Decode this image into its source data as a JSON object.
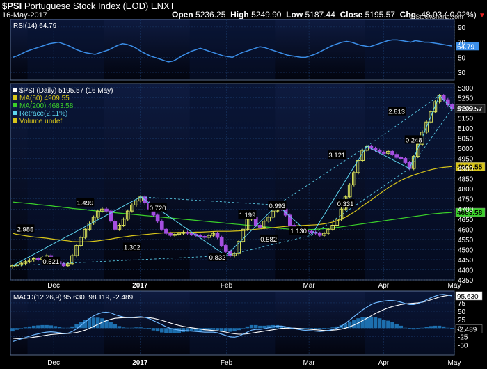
{
  "header": {
    "symbol": "$PSI",
    "name": "Portuguese Stock Index (EOD)",
    "exchange": "ENXT",
    "date": "16-May-2017",
    "open_label": "Open",
    "open": "5236.25",
    "high_label": "High",
    "high": "5249.90",
    "low_label": "Low",
    "low": "5187.44",
    "close_label": "Close",
    "close": "5195.57",
    "chg_label": "Chg",
    "chg": "-48.03 (-0.92%)",
    "copyright": "© StockCharts.com"
  },
  "colors": {
    "background": "#000000",
    "panel_top": "#0e1b40",
    "panel_bottom": "#02040e",
    "shade": "#061028",
    "grid": "#1c3d6e",
    "rsi": "#3b8ee8",
    "ma50": "#d8c61a",
    "ma200": "#3bd02a",
    "retrace": "#5fd6f0",
    "candle_up": "#d8e05a",
    "candle_down": "#a44fe0",
    "macd_line": "#6fb8ff",
    "signal_line": "#ffffff",
    "histogram": "#1d6fae",
    "chg_negative": "#e02020"
  },
  "rsi_panel": {
    "legend": "RSI(14) 64.79",
    "badge": "64.79",
    "ticks": [
      "90",
      "70",
      "50",
      "30"
    ],
    "values": [
      50,
      52,
      55,
      58,
      60,
      62,
      64,
      66,
      68,
      69,
      70,
      68,
      66,
      63,
      60,
      58,
      56,
      55,
      54,
      56,
      58,
      60,
      63,
      66,
      68,
      67,
      65,
      62,
      58,
      55,
      52,
      50,
      48,
      46,
      44,
      45,
      48,
      52,
      55,
      58,
      60,
      62,
      60,
      58,
      56,
      54,
      52,
      51,
      50,
      53,
      56,
      58,
      60,
      62,
      64,
      63,
      61,
      59,
      57,
      55,
      53,
      52,
      51,
      50,
      50,
      52,
      54,
      57,
      60,
      63,
      66,
      68,
      70,
      71,
      70,
      68,
      66,
      65,
      64,
      66,
      68,
      70,
      72,
      73,
      73,
      72,
      71,
      70,
      72,
      71,
      70,
      70,
      69,
      68,
      67,
      66,
      65
    ]
  },
  "price_panel": {
    "legend": [
      {
        "text": "$PSI (Daily) 5195.57 (16 May)",
        "kind": "price"
      },
      {
        "text": "MA(50) 4909.55",
        "kind": "ma50"
      },
      {
        "text": "MA(200) 4683.58",
        "kind": "ma200"
      },
      {
        "text": "Retrace(2.11%)",
        "kind": "retrace"
      },
      {
        "text": "Volume undef",
        "kind": "volume"
      }
    ],
    "ticks": [
      "5300",
      "5250",
      "5200",
      "5150",
      "5100",
      "5050",
      "5000",
      "4950",
      "4900",
      "4850",
      "4800",
      "4750",
      "4700",
      "4650",
      "4600",
      "4550",
      "4500",
      "4450",
      "4400",
      "4350"
    ],
    "badges": [
      {
        "text": "5195.57",
        "value": 5195.57,
        "kind": "close"
      },
      {
        "text": "4909.55",
        "value": 4909.55,
        "kind": "ma50"
      },
      {
        "text": "4683.58",
        "value": 4683.58,
        "kind": "ma200"
      }
    ],
    "retrace_labels": [
      {
        "text": "2.985",
        "value": 4600
      },
      {
        "text": "0.521",
        "value": 4440
      },
      {
        "text": "1.499",
        "value": 4730
      },
      {
        "text": "1.302",
        "value": 4510
      },
      {
        "text": "0.720",
        "value": 4705
      },
      {
        "text": "0.832",
        "value": 4460
      },
      {
        "text": "1.199",
        "value": 4670
      },
      {
        "text": "0.993",
        "value": 4715
      },
      {
        "text": "0.582",
        "value": 4550
      },
      {
        "text": "1.130",
        "value": 4590
      },
      {
        "text": "3.121",
        "value": 4965
      },
      {
        "text": "0.331",
        "value": 4725
      },
      {
        "text": "2.813",
        "value": 5180
      },
      {
        "text": "0.248",
        "value": 5040
      }
    ]
  },
  "macd_panel": {
    "legend": "MACD(12,26,9) 95.630, 98.119, -2.489",
    "ticks": [
      "75",
      "50",
      "25",
      "0",
      "-25",
      "-50"
    ],
    "badges": [
      {
        "text": "95.630",
        "value": 95.63,
        "kind": "macd"
      },
      {
        "text": "-2.489",
        "value": -2.489,
        "kind": "hist"
      }
    ]
  },
  "x_axis": {
    "labels": [
      "Dec",
      "2017",
      "Feb",
      "Mar",
      "Apr",
      "May"
    ]
  },
  "chart_data": {
    "type": "candlestick",
    "title": "$PSI Portuguese Stock Index (EOD) ENXT",
    "ylim": [
      4350,
      5320
    ],
    "x_labels": [
      "Dec",
      "2017",
      "Feb",
      "Mar",
      "Apr",
      "May"
    ],
    "close": [
      4420,
      4425,
      4432,
      4440,
      4448,
      4455,
      4450,
      4460,
      4470,
      4455,
      4440,
      4430,
      4420,
      4430,
      4470,
      4520,
      4560,
      4600,
      4630,
      4660,
      4690,
      4700,
      4690,
      4640,
      4600,
      4620,
      4650,
      4690,
      4720,
      4740,
      4760,
      4730,
      4700,
      4670,
      4640,
      4600,
      4580,
      4570,
      4575,
      4580,
      4585,
      4580,
      4575,
      4570,
      4565,
      4560,
      4570,
      4580,
      4560,
      4520,
      4490,
      4470,
      4480,
      4540,
      4600,
      4650,
      4660,
      4620,
      4610,
      4640,
      4660,
      4690,
      4710,
      4700,
      4670,
      4620,
      4590,
      4600,
      4595,
      4590,
      4585,
      4580,
      4570,
      4580,
      4600,
      4620,
      4650,
      4700,
      4760,
      4820,
      4880,
      4940,
      4990,
      5010,
      5000,
      4990,
      4980,
      4975,
      4985,
      4970,
      4955,
      4950,
      4930,
      4900,
      4960,
      5020,
      5080,
      5130,
      5180,
      5230,
      5260,
      5240,
      5215,
      5195.57
    ],
    "ma50": [
      4580,
      4575,
      4572,
      4568,
      4565,
      4562,
      4560,
      4558,
      4556,
      4553,
      4550,
      4548,
      4545,
      4543,
      4540,
      4539,
      4538,
      4538,
      4539,
      4541,
      4543,
      4546,
      4549,
      4552,
      4556,
      4559,
      4562,
      4565,
      4568,
      4570,
      4572,
      4574,
      4576,
      4578,
      4580,
      4582,
      4583,
      4584,
      4584,
      4585,
      4585,
      4585,
      4585,
      4586,
      4586,
      4587,
      4588,
      4589,
      4590,
      4590,
      4590,
      4590,
      4591,
      4592,
      4594,
      4596,
      4598,
      4600,
      4602,
      4604,
      4606,
      4608,
      4610,
      4612,
      4614,
      4616,
      4617,
      4618,
      4619,
      4620,
      4621,
      4622,
      4624,
      4627,
      4631,
      4636,
      4642,
      4650,
      4660,
      4672,
      4685,
      4700,
      4715,
      4730,
      4745,
      4760,
      4775,
      4790,
      4805,
      4818,
      4830,
      4842,
      4852,
      4860,
      4868,
      4875,
      4882,
      4888,
      4894,
      4899,
      4903,
      4906,
      4908,
      4909.55
    ],
    "ma200": [
      4735,
      4733,
      4731,
      4729,
      4727,
      4725,
      4722,
      4720,
      4718,
      4716,
      4713,
      4711,
      4708,
      4706,
      4703,
      4701,
      4699,
      4697,
      4694,
      4692,
      4690,
      4688,
      4686,
      4684,
      4682,
      4680,
      4678,
      4676,
      4674,
      4672,
      4670,
      4668,
      4666,
      4664,
      4662,
      4660,
      4658,
      4656,
      4654,
      4652,
      4650,
      4648,
      4646,
      4644,
      4642,
      4640,
      4638,
      4636,
      4634,
      4632,
      4630,
      4628,
      4626,
      4624,
      4622,
      4620,
      4618,
      4616,
      4614,
      4612,
      4610,
      4608,
      4606,
      4604,
      4602,
      4600,
      4599,
      4598,
      4598,
      4598,
      4599,
      4600,
      4601,
      4603,
      4605,
      4607,
      4609,
      4612,
      4615,
      4618,
      4621,
      4624,
      4627,
      4630,
      4633,
      4636,
      4639,
      4642,
      4645,
      4648,
      4651,
      4654,
      4657,
      4660,
      4663,
      4666,
      4669,
      4672,
      4675,
      4677,
      4679,
      4681,
      4682,
      4683.58
    ],
    "macd": [
      -40,
      -36,
      -32,
      -28,
      -24,
      -20,
      -17,
      -14,
      -12,
      -11,
      -12,
      -14,
      -16,
      -15,
      -10,
      -2,
      8,
      18,
      28,
      36,
      42,
      46,
      47,
      45,
      40,
      36,
      33,
      32,
      32,
      33,
      34,
      32,
      28,
      22,
      16,
      10,
      4,
      -1,
      -4,
      -6,
      -7,
      -8,
      -9,
      -10,
      -11,
      -12,
      -12,
      -12,
      -14,
      -18,
      -22,
      -26,
      -27,
      -24,
      -18,
      -12,
      -6,
      -4,
      -4,
      -2,
      1,
      4,
      6,
      6,
      4,
      1,
      -2,
      -4,
      -6,
      -7,
      -8,
      -9,
      -10,
      -9,
      -7,
      -4,
      0,
      6,
      14,
      24,
      34,
      44,
      54,
      62,
      70,
      75,
      78,
      80,
      82,
      82,
      80,
      77,
      73,
      70,
      70,
      73,
      78,
      84,
      90,
      95,
      99,
      100,
      98,
      95.63
    ],
    "signal": [
      -30,
      -31,
      -31,
      -30,
      -29,
      -27,
      -25,
      -23,
      -21,
      -19,
      -18,
      -17,
      -17,
      -16,
      -15,
      -13,
      -10,
      -6,
      -1,
      5,
      11,
      17,
      22,
      26,
      29,
      30,
      31,
      31,
      31,
      31,
      32,
      32,
      31,
      29,
      26,
      23,
      19,
      15,
      11,
      8,
      5,
      3,
      1,
      -1,
      -3,
      -5,
      -6,
      -7,
      -8,
      -10,
      -12,
      -15,
      -17,
      -18,
      -18,
      -17,
      -15,
      -13,
      -11,
      -9,
      -7,
      -5,
      -3,
      -1,
      0,
      0,
      0,
      -1,
      -2,
      -3,
      -4,
      -5,
      -6,
      -7,
      -7,
      -6,
      -5,
      -3,
      0,
      4,
      9,
      15,
      22,
      29,
      36,
      43,
      49,
      55,
      60,
      64,
      67,
      70,
      72,
      73,
      74,
      75,
      77,
      80,
      84,
      88,
      92,
      95,
      97,
      98.119
    ]
  }
}
